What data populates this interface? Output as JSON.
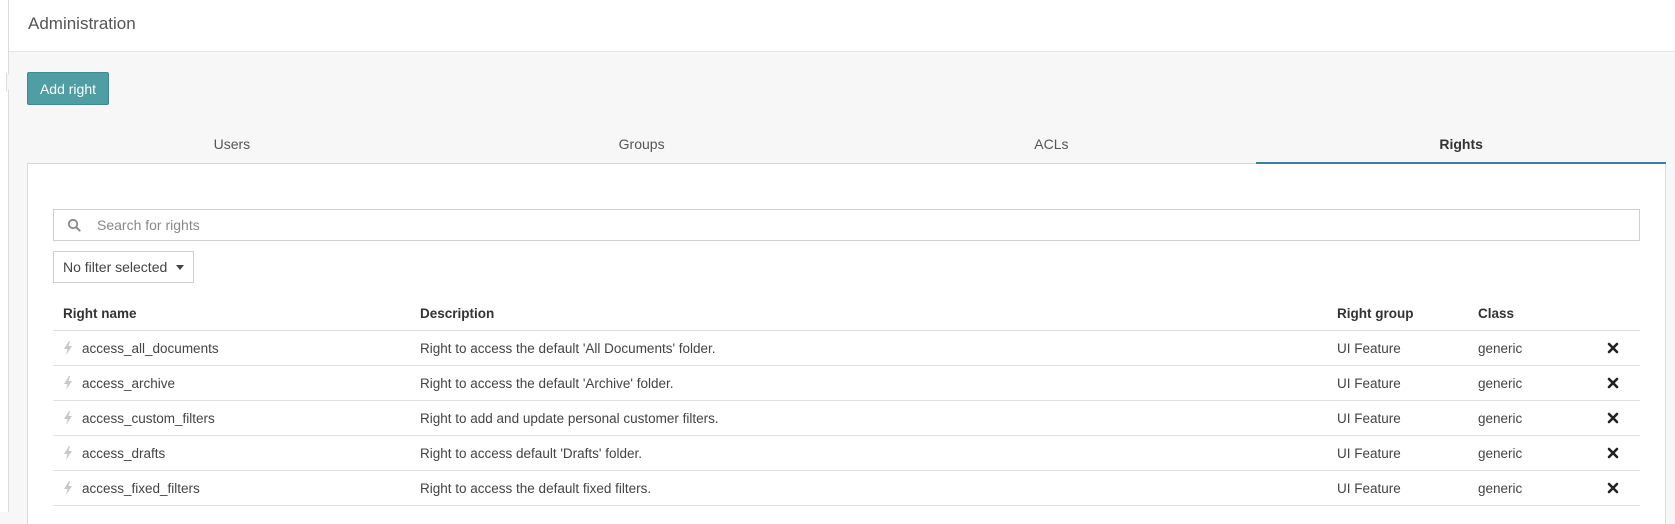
{
  "header": {
    "title": "Administration"
  },
  "toolbar": {
    "add_right_label": "Add right"
  },
  "tabs": [
    {
      "label": "Users",
      "active": false
    },
    {
      "label": "Groups",
      "active": false
    },
    {
      "label": "ACLs",
      "active": false
    },
    {
      "label": "Rights",
      "active": true
    }
  ],
  "search": {
    "placeholder": "Search for rights",
    "value": "",
    "icon": "search-icon"
  },
  "filter": {
    "selected": "No filter selected"
  },
  "table": {
    "columns": [
      "Right name",
      "Description",
      "Right group",
      "Class"
    ],
    "rows": [
      {
        "name": "access_all_documents",
        "description": "Right to access the default 'All Documents' folder.",
        "group": "UI Feature",
        "class": "generic"
      },
      {
        "name": "access_archive",
        "description": "Right to access the default 'Archive' folder.",
        "group": "UI Feature",
        "class": "generic"
      },
      {
        "name": "access_custom_filters",
        "description": "Right to add and update personal customer filters.",
        "group": "UI Feature",
        "class": "generic"
      },
      {
        "name": "access_drafts",
        "description": "Right to access default 'Drafts' folder.",
        "group": "UI Feature",
        "class": "generic"
      },
      {
        "name": "access_fixed_filters",
        "description": "Right to access the default fixed filters.",
        "group": "UI Feature",
        "class": "generic"
      }
    ]
  },
  "colors": {
    "accent": "#4e9ea3",
    "active_tab_border": "#3a7fa6"
  }
}
